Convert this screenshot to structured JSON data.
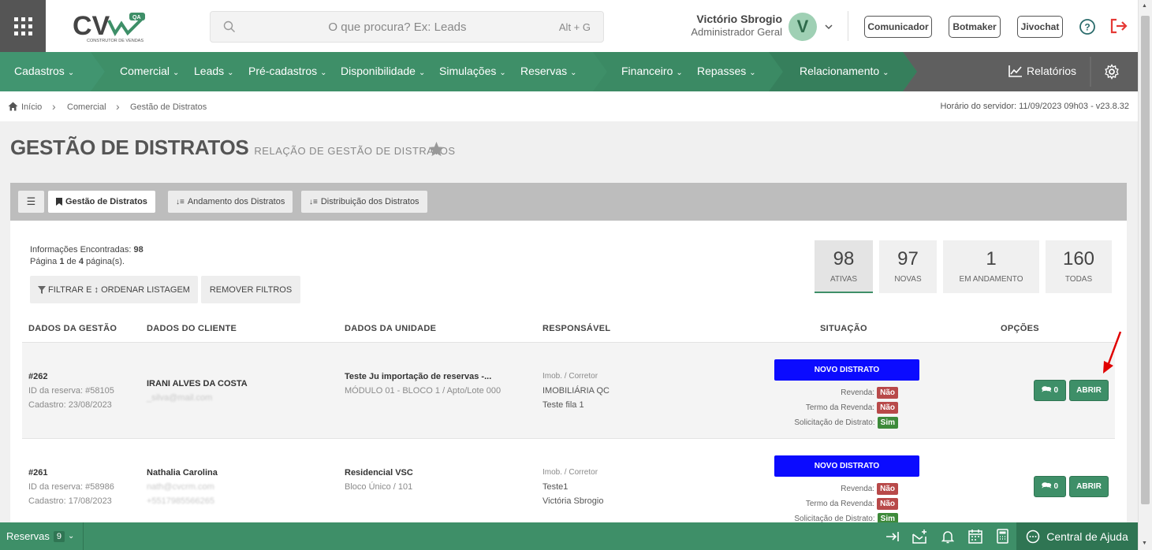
{
  "header": {
    "logo_text": "CV",
    "logo_badge": "QA",
    "logo_tagline": "CONSTRUTOR DE VENDAS",
    "search_placeholder": "O que procura? Ex: Leads",
    "search_shortcut": "Alt + G",
    "user_name": "Victório Sbrogio",
    "user_role": "Administrador Geral",
    "avatar_letter": "V",
    "buttons": [
      "Comunicador",
      "Botmaker",
      "Jivochat"
    ]
  },
  "nav": {
    "items": [
      "Cadastros",
      "Comercial",
      "Leads",
      "Pré-cadastros",
      "Disponibilidade",
      "Simulações",
      "Reservas",
      "Financeiro",
      "Repasses",
      "Relacionamento"
    ],
    "reports": "Relatórios"
  },
  "breadcrumb": {
    "items": [
      "Início",
      "Comercial",
      "Gestão de Distratos"
    ],
    "server_time": "Horário do servidor: 11/09/2023 09h03 - v23.8.32"
  },
  "page": {
    "title": "GESTÃO DE DISTRATOS",
    "subtitle": "RELAÇÃO DE GESTÃO DE DISTRATOS"
  },
  "tabs": [
    "Gestão de Distratos",
    "Andamento dos Distratos",
    "Distribuição dos Distratos"
  ],
  "summary": {
    "found_label": "Informações Encontradas:",
    "found_value": "98",
    "page_prefix": "Página",
    "page_current": "1",
    "page_of": "de",
    "page_total": "4",
    "page_suffix": "página(s).",
    "filter_button": "FILTRAR E ↕ ORDENAR LISTAGEM",
    "remove_filters": "REMOVER FILTROS"
  },
  "stats": [
    {
      "value": "98",
      "label": "ATIVAS"
    },
    {
      "value": "97",
      "label": "NOVAS"
    },
    {
      "value": "1",
      "label": "EM ANDAMENTO"
    },
    {
      "value": "160",
      "label": "TODAS"
    }
  ],
  "table": {
    "headers": [
      "DADOS DA GESTÃO",
      "DADOS DO CLIENTE",
      "DADOS DA UNIDADE",
      "RESPONSÁVEL",
      "SITUAÇÃO",
      "OPÇÕES"
    ],
    "flag_labels": [
      "Revenda:",
      "Termo da Revenda:",
      "Solicitação de Distrato:"
    ],
    "rows": [
      {
        "id": "#262",
        "reserva": "ID da reserva: #58105",
        "cadastro": "Cadastro: 23/08/2023",
        "client_name": "IRANI ALVES DA COSTA",
        "client_email": "_silva@mail.com",
        "client_phone": "",
        "unit_name": "Teste Ju importação de reservas -...",
        "unit_detail": "MÓDULO 01 - BLOCO 1 / Apto/Lote 000",
        "resp_label": "Imob. / Corretor",
        "resp_1": "IMOBILIÁRIA QC",
        "resp_2": "Teste fila 1",
        "status": "NOVO DISTRATO",
        "revenda": "Não",
        "termo": "Não",
        "solicitacao": "Sim",
        "comments": "0",
        "open_label": "ABRIR"
      },
      {
        "id": "#261",
        "reserva": "ID da reserva: #58986",
        "cadastro": "Cadastro: 17/08/2023",
        "client_name": "Nathalia Carolina",
        "client_email": "nath@cvcrm.com",
        "client_phone": "+5517985566265",
        "unit_name": "Residencial VSC",
        "unit_detail": "Bloco Único / 101",
        "resp_label": "Imob. / Corretor",
        "resp_1": "Teste1",
        "resp_2": "Victória Sbrogio",
        "status": "NOVO DISTRATO",
        "revenda": "Não",
        "termo": "Não",
        "solicitacao": "Sim",
        "comments": "0",
        "open_label": "ABRIR"
      }
    ]
  },
  "footer": {
    "reservas_label": "Reservas",
    "reservas_count": "9",
    "help_label": "Central de Ajuda"
  },
  "colors": {
    "brand_green": "#3e8f68",
    "status_blue": "#0b0bff",
    "badge_no": "#b84949",
    "badge_yes": "#3d8a3a"
  }
}
